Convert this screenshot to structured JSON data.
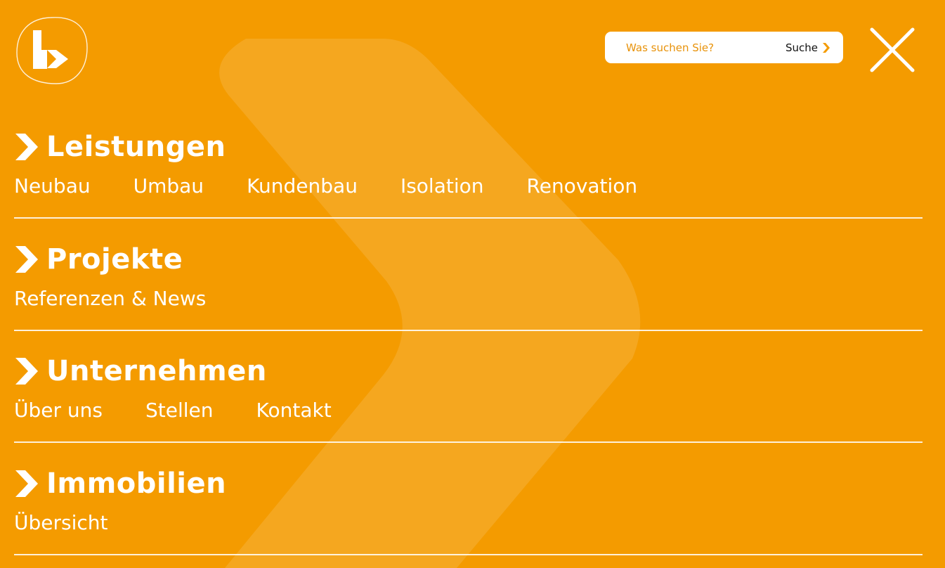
{
  "colors": {
    "background": "#f49b00",
    "accent_text": "#e8920a",
    "foreground": "#ffffff"
  },
  "logo": {
    "icon": "brand-logo-icon"
  },
  "search": {
    "placeholder": "Was suchen Sie?",
    "value": "",
    "button_label": "Suche",
    "button_icon": "chevron-right-icon"
  },
  "close": {
    "icon": "close-icon"
  },
  "nav": {
    "sections": [
      {
        "title": "Leistungen",
        "icon": "chevron-right-icon",
        "links": [
          "Neubau",
          "Umbau",
          "Kundenbau",
          "Isolation",
          "Renovation"
        ]
      },
      {
        "title": "Projekte",
        "icon": "chevron-right-icon",
        "links": [
          "Referenzen & News"
        ]
      },
      {
        "title": "Unternehmen",
        "icon": "chevron-right-icon",
        "links": [
          "Über uns",
          "Stellen",
          "Kontakt"
        ]
      },
      {
        "title": "Immobilien",
        "icon": "chevron-right-icon",
        "links": [
          "Übersicht"
        ]
      }
    ]
  }
}
